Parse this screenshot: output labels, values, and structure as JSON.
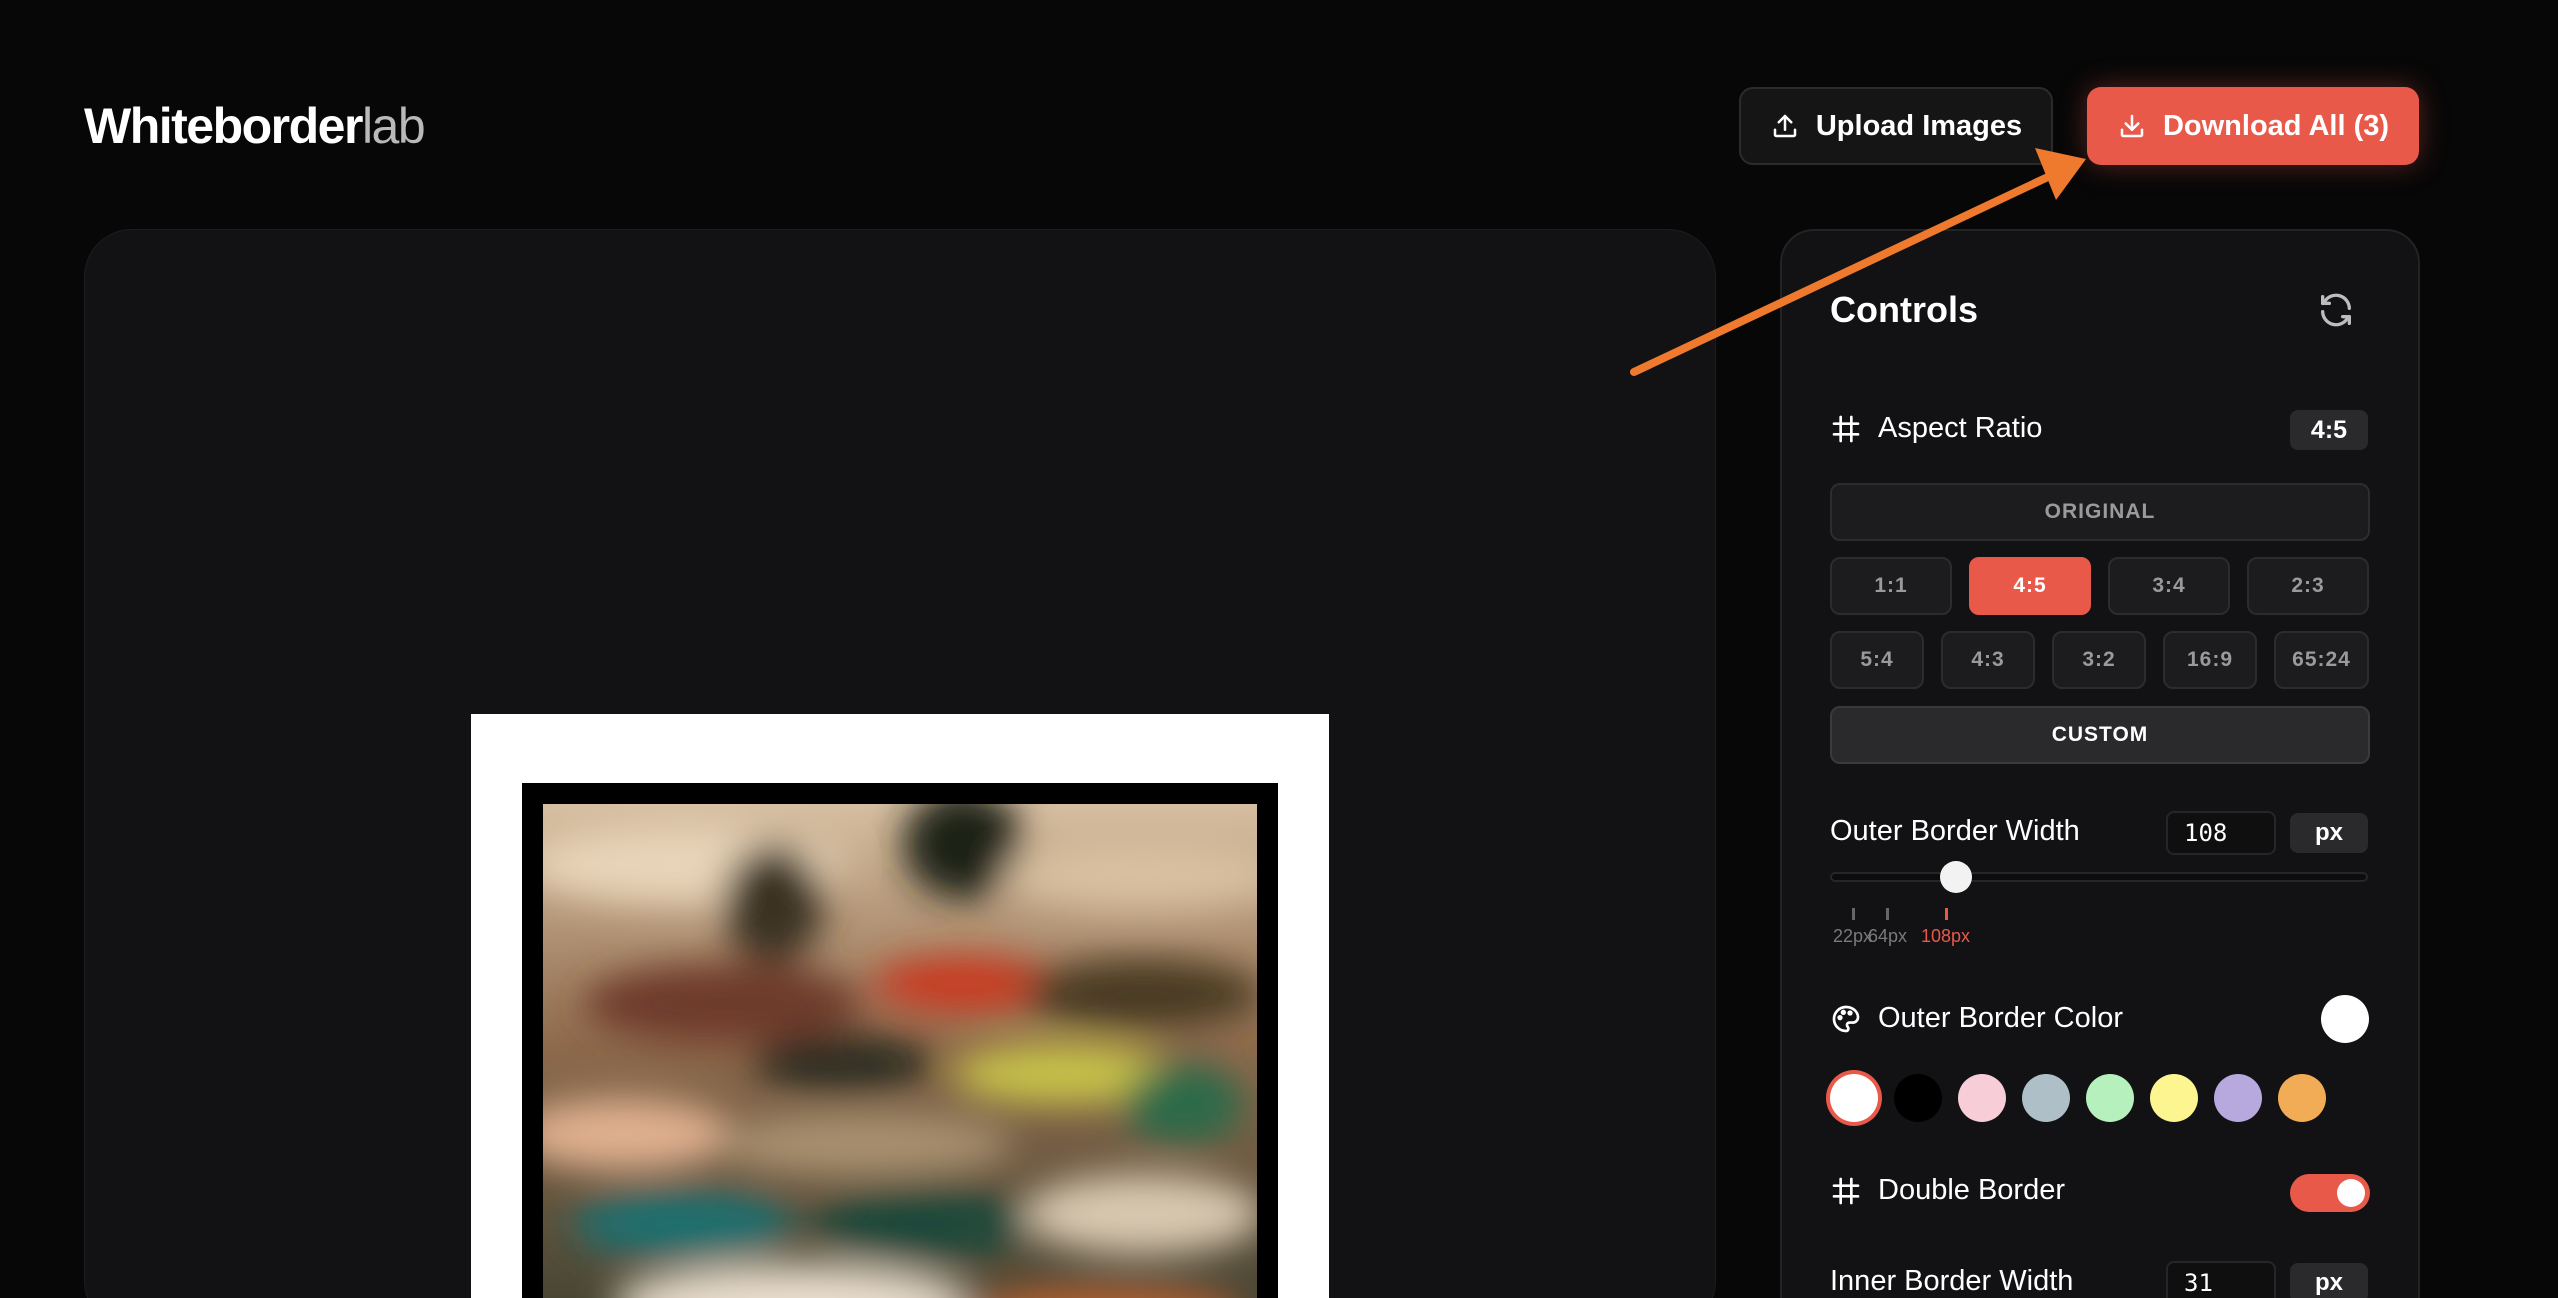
{
  "header": {
    "logo_bold": "Whiteborder",
    "logo_light": "lab",
    "upload_label": "Upload Images",
    "download_label": "Download All (3)"
  },
  "controls": {
    "title": "Controls",
    "aspect_ratio": {
      "label": "Aspect Ratio",
      "current": "4:5",
      "original_label": "ORIGINAL",
      "row1": [
        "1:1",
        "4:5",
        "3:4",
        "2:3"
      ],
      "row2": [
        "5:4",
        "4:3",
        "3:2",
        "16:9",
        "65:24"
      ],
      "custom_label": "CUSTOM",
      "selected": "4:5"
    },
    "outer_border_width": {
      "label": "Outer Border Width",
      "value": "108",
      "unit": "px",
      "ticks": [
        "22px",
        "64px",
        "108px"
      ],
      "active_tick": "108px"
    },
    "outer_border_color": {
      "label": "Outer Border Color",
      "current": "#ffffff",
      "swatches": [
        "#ffffff",
        "#000000",
        "#f7cdd8",
        "#aebfc8",
        "#b6f0bd",
        "#fcf590",
        "#b7a8de",
        "#f2ac55"
      ],
      "selected_index": 0
    },
    "double_border": {
      "label": "Double Border",
      "enabled": true
    },
    "inner_border_width": {
      "label": "Inner Border Width",
      "value": "31",
      "unit": "px"
    }
  },
  "colors": {
    "accent": "#e9594a",
    "annotation_arrow": "#ef7a2e"
  }
}
